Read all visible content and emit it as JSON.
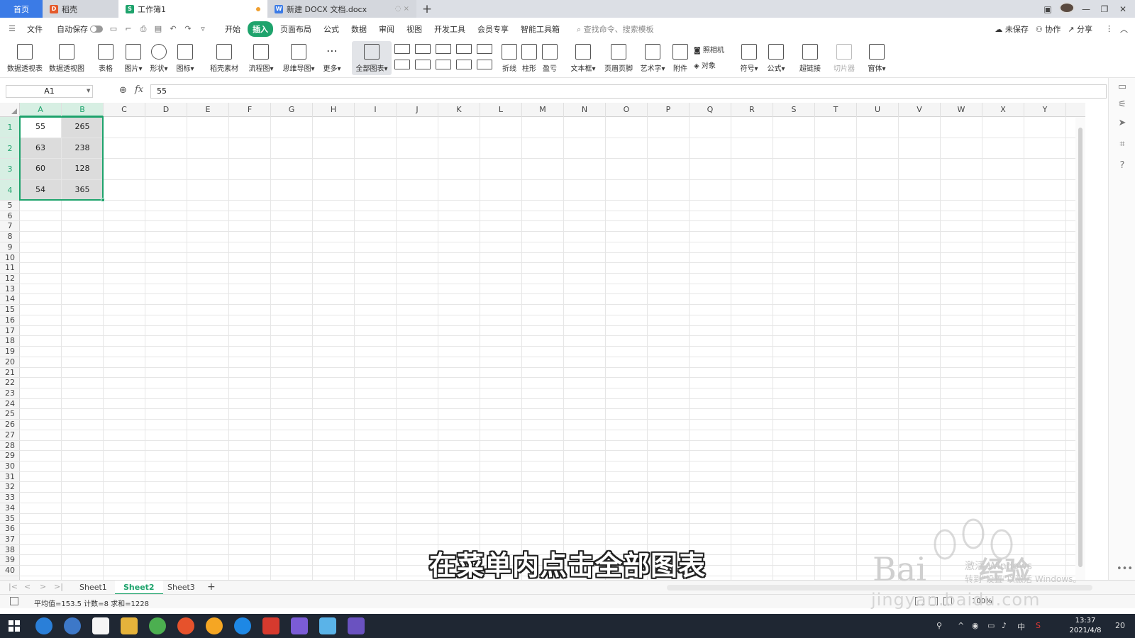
{
  "window": {
    "tabs": [
      {
        "label": "首页"
      },
      {
        "label": "稻壳"
      },
      {
        "label": "工作簿1"
      },
      {
        "label": "新建 DOCX 文档.docx"
      }
    ],
    "add_tab": "+"
  },
  "menu": {
    "file": "文件",
    "autosave": "自动保存",
    "items": [
      "开始",
      "插入",
      "页面布局",
      "公式",
      "数据",
      "审阅",
      "视图",
      "开发工具",
      "会员专享",
      "智能工具箱"
    ],
    "active_item": "插入",
    "search_placeholder": "查找命令、搜索模板",
    "right": {
      "unsaved": "未保存",
      "collaborate": "协作",
      "share": "分享"
    }
  },
  "ribbon": {
    "buttons": [
      {
        "label": "数据透视表"
      },
      {
        "label": "数据透视图"
      },
      {
        "label": "表格"
      },
      {
        "label": "图片▾"
      },
      {
        "label": "形状▾"
      },
      {
        "label": "图标▾"
      },
      {
        "label": "稻壳素材"
      },
      {
        "label": "流程图▾"
      },
      {
        "label": "思维导图▾"
      },
      {
        "label": "更多▾"
      },
      {
        "label": "全部图表▾"
      },
      {
        "label": "折线"
      },
      {
        "label": "柱形"
      },
      {
        "label": "盈亏"
      },
      {
        "label": "文本框▾"
      },
      {
        "label": "页眉页脚"
      },
      {
        "label": "艺术字▾"
      },
      {
        "label": "附件"
      },
      {
        "label": "符号▾"
      },
      {
        "label": "公式▾"
      },
      {
        "label": "超链接"
      },
      {
        "label": "切片器"
      },
      {
        "label": "窗体▾"
      }
    ],
    "camera": "照相机",
    "object": "对象"
  },
  "formula_bar": {
    "name_box": "A1",
    "fx": "fx",
    "value": "55"
  },
  "sheet": {
    "columns": [
      "A",
      "B",
      "C",
      "D",
      "E",
      "F",
      "G",
      "H",
      "I",
      "J",
      "K",
      "L",
      "M",
      "N",
      "O",
      "P",
      "Q",
      "R",
      "S",
      "T",
      "U",
      "V",
      "W",
      "X",
      "Y"
    ],
    "row_count": 40,
    "cells": [
      [
        "55",
        "265"
      ],
      [
        "63",
        "238"
      ],
      [
        "60",
        "128"
      ],
      [
        "54",
        "365"
      ]
    ]
  },
  "sheet_tabs": {
    "tabs": [
      "Sheet1",
      "Sheet2",
      "Sheet3"
    ],
    "active": "Sheet2",
    "add": "+"
  },
  "status": {
    "summary": "平均值=153.5  计数=8  求和=1228",
    "zoom": "100%"
  },
  "taskbar": {
    "time": "13:37",
    "date": "2021/4/8",
    "ime": "中",
    "notif": "20"
  },
  "caption": "在菜单内点击全部图表",
  "watermark": {
    "brand": "Bai",
    "brand2": "经验",
    "url": "jingyan.baidu.com",
    "activate1": "激活 Windows",
    "activate2": "转到\"设置\"以激活 Windows。"
  },
  "colors": {
    "accent": "#1ea36c",
    "home_tab": "#3b7be6",
    "taskbar": "#1f2733"
  }
}
